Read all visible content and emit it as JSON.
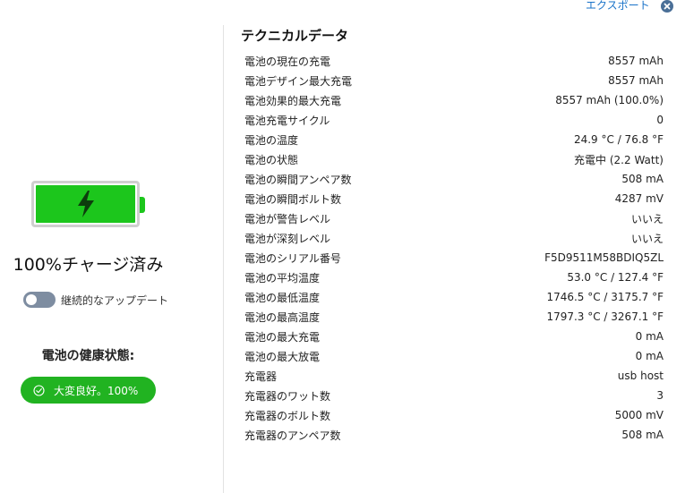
{
  "header": {
    "export_label": "エクスポート"
  },
  "battery": {
    "charge_label": "100%チャージ済み",
    "level_fraction": 1.0,
    "fill_color": "#1cc61c",
    "icon": "lightning-bolt-icon",
    "auto_update_label": "継続的なアップデート",
    "auto_update_on": false
  },
  "health": {
    "title": "電池の健康状態:",
    "badge_label": "大変良好。100%",
    "badge_color": "#21b321"
  },
  "tech": {
    "title": "テクニカルデータ",
    "rows": [
      {
        "key": "電池の現在の充電",
        "value": "8557 mAh"
      },
      {
        "key": "電池デザイン最大充電",
        "value": "8557 mAh"
      },
      {
        "key": "電池効果的最大充電",
        "value": "8557 mAh (100.0%)"
      },
      {
        "key": "電池充電サイクル",
        "value": "0"
      },
      {
        "key": "電池の温度",
        "value": "24.9 °C / 76.8 °F"
      },
      {
        "key": "電池の状態",
        "value": "充電中 (2.2 Watt)"
      },
      {
        "key": "電池の瞬間アンペア数",
        "value": "508 mA"
      },
      {
        "key": "電池の瞬間ボルト数",
        "value": "4287 mV"
      },
      {
        "key": "電池が警告レベル",
        "value": "いいえ"
      },
      {
        "key": "電池が深刻レベル",
        "value": "いいえ"
      },
      {
        "key": "電池のシリアル番号",
        "value": "F5D9511M58BDIQ5ZL"
      },
      {
        "key": "電池の平均温度",
        "value": "53.0 °C / 127.4 °F"
      },
      {
        "key": "電池の最低温度",
        "value": "1746.5 °C / 3175.7 °F"
      },
      {
        "key": "電池の最高温度",
        "value": "1797.3 °C / 3267.1 °F"
      },
      {
        "key": "電池の最大充電",
        "value": "0 mA"
      },
      {
        "key": "電池の最大放電",
        "value": "0 mA"
      },
      {
        "key": "充電器",
        "value": "usb host"
      },
      {
        "key": "充電器のワット数",
        "value": "3"
      },
      {
        "key": "充電器のボルト数",
        "value": "5000 mV"
      },
      {
        "key": "充電器のアンペア数",
        "value": "508 mA"
      }
    ]
  }
}
